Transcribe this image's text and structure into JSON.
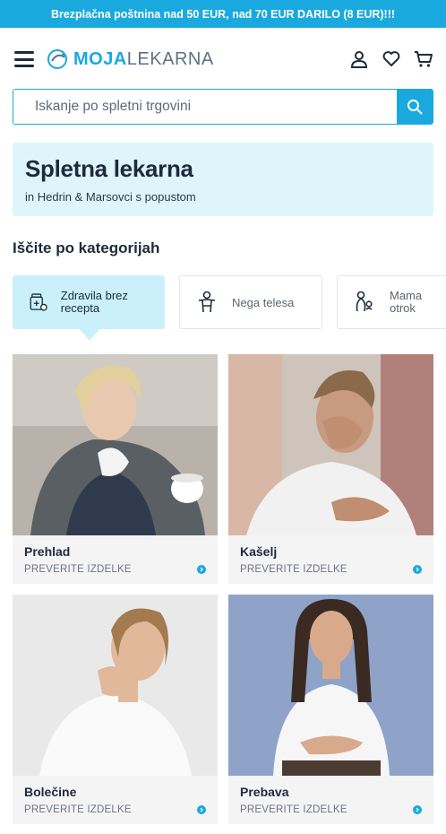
{
  "promo_bar": {
    "text": "Brezplačna poštnina nad 50 EUR, nad 70 EUR DARILO (8 EUR)!!!"
  },
  "header": {
    "logo_strong": "MOJA",
    "logo_light": "LEKARNA",
    "icons": [
      "menu-icon",
      "user-icon",
      "heart-icon",
      "cart-icon"
    ]
  },
  "search": {
    "placeholder": "Iskanje po spletni trgovini"
  },
  "hero": {
    "title": "Spletna lekarna",
    "subtitle": "in Hedrin & Marsovci s popustom"
  },
  "categories": {
    "heading": "Iščite po kategorijah",
    "items": [
      {
        "label": "Zdravila brez recepta",
        "icon": "pills-bottle-icon"
      },
      {
        "label": "Nega telesa",
        "icon": "body-care-icon"
      },
      {
        "label": "Mama otrok",
        "icon": "mother-child-icon"
      }
    ]
  },
  "products": [
    {
      "name": "Prehlad",
      "cta": "PREVERITE IZDELKE"
    },
    {
      "name": "Kašelj",
      "cta": "PREVERITE IZDELKE"
    },
    {
      "name": "Bolečine",
      "cta": "PREVERITE IZDELKE"
    },
    {
      "name": "Prebava",
      "cta": "PREVERITE IZDELKE"
    }
  ],
  "colors": {
    "brand": "#1aa9de",
    "hero_bg": "#def5fc",
    "active_cat": "#c9f0fb"
  }
}
